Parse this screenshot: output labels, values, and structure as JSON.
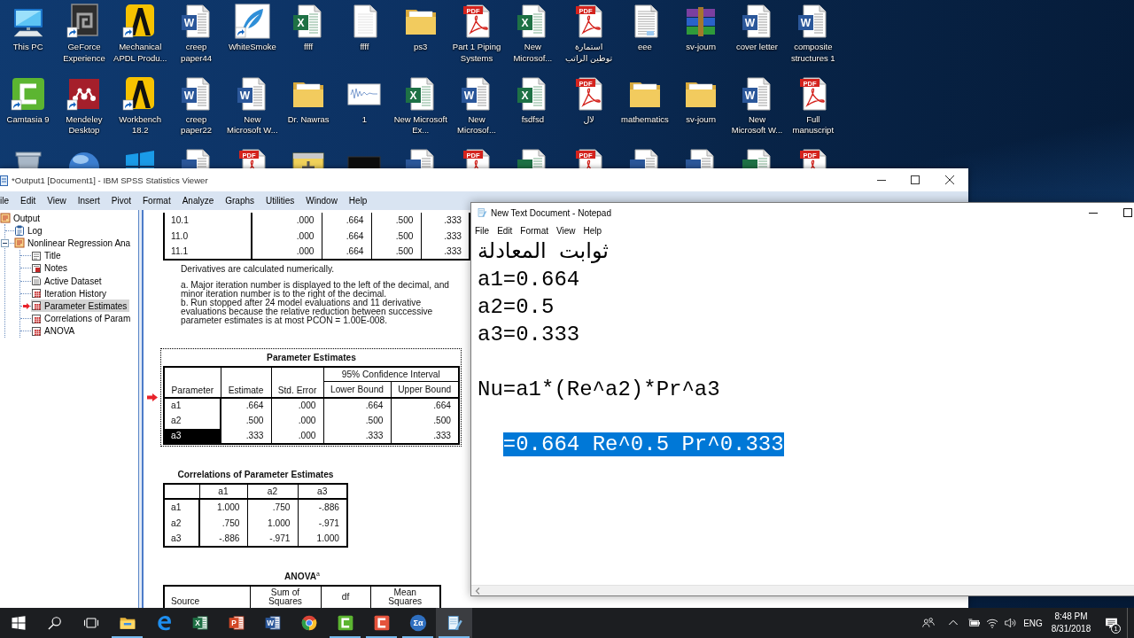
{
  "desktop": {
    "icons": [
      {
        "label": "This PC",
        "kind": "computer",
        "shortcut": false
      },
      {
        "label": "GeForce Experience",
        "kind": "geforce",
        "shortcut": true
      },
      {
        "label": "Mechanical APDL Produ...",
        "kind": "ansys",
        "shortcut": true
      },
      {
        "label": "creep paper44",
        "kind": "word",
        "badge": "W",
        "shortcut": false
      },
      {
        "label": "WhiteSmoke",
        "kind": "feather",
        "shortcut": true
      },
      {
        "label": "ffff",
        "kind": "excel",
        "badge": "X",
        "shortcut": false
      },
      {
        "label": "ffff",
        "kind": "blank",
        "shortcut": false
      },
      {
        "label": "ps3",
        "kind": "folder",
        "shortcut": false
      },
      {
        "label": "Part 1 Piping Systems",
        "kind": "pdf",
        "badge": "PDF",
        "shortcut": false
      },
      {
        "label": "New Microsof...",
        "kind": "excel",
        "badge": "X",
        "shortcut": false
      },
      {
        "label": "استمارة توطين الراتب",
        "kind": "pdf",
        "badge": "PDF",
        "shortcut": false
      },
      {
        "label": "eee",
        "kind": "scan",
        "shortcut": false
      },
      {
        "label": "sv-journ",
        "kind": "archive",
        "shortcut": false
      },
      {
        "label": "cover letter",
        "kind": "word",
        "badge": "W",
        "shortcut": false
      },
      {
        "label": "composite structures 1",
        "kind": "word",
        "badge": "W",
        "shortcut": false
      },
      {
        "label": "Camtasia 9",
        "kind": "camtasia",
        "shortcut": true
      },
      {
        "label": "Mendeley Desktop",
        "kind": "mendeley",
        "shortcut": true
      },
      {
        "label": "Workbench 18.2",
        "kind": "ansys",
        "shortcut": true
      },
      {
        "label": "creep paper22",
        "kind": "word",
        "badge": "W",
        "shortcut": false
      },
      {
        "label": "New Microsoft W...",
        "kind": "word",
        "badge": "W",
        "shortcut": false
      },
      {
        "label": "Dr. Nawras",
        "kind": "folder",
        "shortcut": false
      },
      {
        "label": "1",
        "kind": "image",
        "shortcut": false
      },
      {
        "label": "New Microsoft Ex...",
        "kind": "excel",
        "badge": "X",
        "shortcut": false
      },
      {
        "label": "New Microsof...",
        "kind": "word",
        "badge": "W",
        "shortcut": false
      },
      {
        "label": "fsdfsd",
        "kind": "excel",
        "badge": "X",
        "shortcut": false
      },
      {
        "label": "لال",
        "kind": "pdf",
        "badge": "PDF",
        "shortcut": false
      },
      {
        "label": "mathematics",
        "kind": "folder",
        "shortcut": false
      },
      {
        "label": "sv-journ",
        "kind": "folder",
        "shortcut": false
      },
      {
        "label": "New Microsoft W...",
        "kind": "word",
        "badge": "W",
        "shortcut": false
      },
      {
        "label": "Full manuscript",
        "kind": "pdf",
        "badge": "PDF",
        "shortcut": false
      }
    ],
    "covered_icons": [
      {
        "kind": "recycle"
      },
      {
        "kind": "sigma"
      },
      {
        "kind": "windows"
      },
      {
        "kind": "word"
      },
      {
        "kind": "pdf",
        "badge": "PDF"
      },
      {
        "kind": "labview"
      },
      {
        "kind": "screen"
      },
      {
        "kind": "word"
      },
      {
        "kind": "pdf",
        "badge": "PDF"
      },
      {
        "kind": "excel"
      },
      {
        "kind": "pdf",
        "badge": "PDF"
      },
      {
        "kind": "word"
      },
      {
        "kind": "word"
      },
      {
        "kind": "excel"
      },
      {
        "kind": "pdf",
        "badge": "PDF"
      }
    ]
  },
  "spss": {
    "title": "*Output1 [Document1] - IBM SPSS Statistics Viewer",
    "menu": [
      "ile",
      "Edit",
      "View",
      "Insert",
      "Pivot",
      "Format",
      "Analyze",
      "Graphs",
      "Utilities",
      "Window",
      "Help"
    ],
    "outline": [
      {
        "label": "Output",
        "kind": "book",
        "selected": false,
        "children": [
          {
            "label": "Log",
            "kind": "log",
            "selected": false
          },
          {
            "label": "Nonlinear Regression Ana",
            "kind": "book",
            "selected": false,
            "expanded": true,
            "children": [
              {
                "label": "Title",
                "kind": "title",
                "selected": false
              },
              {
                "label": "Notes",
                "kind": "notes",
                "selected": false
              },
              {
                "label": "Active Dataset",
                "kind": "dataset",
                "selected": false
              },
              {
                "label": "Iteration History",
                "kind": "table",
                "selected": false
              },
              {
                "label": "Parameter Estimates",
                "kind": "table",
                "selected": true
              },
              {
                "label": "Correlations of Param",
                "kind": "table",
                "selected": false
              },
              {
                "label": "ANOVA",
                "kind": "table",
                "selected": false
              }
            ]
          }
        ]
      }
    ],
    "tables": [
      {
        "kind": "iteration",
        "rows": [
          [
            "10.1",
            ".000",
            ".664",
            ".500",
            ".333"
          ],
          [
            "11.0",
            ".000",
            ".664",
            ".500",
            ".333"
          ],
          [
            "11.1",
            ".000",
            ".664",
            ".500",
            ".333"
          ]
        ],
        "note": "Derivatives are calculated numerically.",
        "footnotes": [
          "a. Major iteration number is displayed to the left of the decimal, and minor iteration number is to the right of the decimal.",
          "b. Run stopped after 24 model evaluations and 11 derivative evaluations because the relative reduction between successive parameter estimates is at most PCON = 1.00E-008."
        ]
      },
      {
        "kind": "estimates",
        "title": "Parameter Estimates",
        "selected": true,
        "columns": [
          "Parameter",
          "Estimate",
          "Std. Error"
        ],
        "group_header": "95% Confidence Interval",
        "group_columns": [
          "Lower Bound",
          "Upper Bound"
        ],
        "rows": [
          {
            "label": "a1",
            "selected": false,
            "values": [
              ".664",
              ".000",
              ".664",
              ".664"
            ]
          },
          {
            "label": "a2",
            "selected": false,
            "values": [
              ".500",
              ".000",
              ".500",
              ".500"
            ]
          },
          {
            "label": "a3",
            "selected": true,
            "values": [
              ".333",
              ".000",
              ".333",
              ".333"
            ]
          }
        ]
      },
      {
        "kind": "correlations",
        "title": "Correlations of Parameter Estimates",
        "selected": false,
        "columns": [
          "a1",
          "a2",
          "a3"
        ],
        "rows": [
          {
            "label": "a1",
            "values": [
              "1.000",
              ".750",
              "-.886"
            ]
          },
          {
            "label": "a2",
            "values": [
              ".750",
              "1.000",
              "-.971"
            ]
          },
          {
            "label": "a3",
            "values": [
              "-.886",
              "-.971",
              "1.000"
            ]
          }
        ]
      },
      {
        "kind": "anova",
        "title": "ANOVA$^{a}$",
        "selected": false,
        "columns": [
          "Source",
          "Sum of Squares",
          "df",
          "Mean Squares"
        ]
      }
    ]
  },
  "notepad": {
    "title": "New Text Document - Notepad",
    "menu": [
      "File",
      "Edit",
      "Format",
      "View",
      "Help"
    ],
    "text": "ثوابت المعادلة\na1=0.664\na2=0.5\na3=0.333\n\nNu=a1*(Re^a2)*Pr^a3\n\n  ",
    "selected_text": "=0.664 Re^0.5 Pr^0.333"
  },
  "taskbar": {
    "buttons": [
      {
        "kind": "start"
      },
      {
        "kind": "search"
      },
      {
        "kind": "taskview"
      }
    ],
    "apps": [
      {
        "kind": "explorer",
        "running": true,
        "active": false
      },
      {
        "kind": "edge",
        "running": false,
        "active": false
      },
      {
        "kind": "excel",
        "badge": "X",
        "running": false,
        "active": false
      },
      {
        "kind": "powerpoint",
        "badge": "P",
        "running": false,
        "active": false
      },
      {
        "kind": "word",
        "badge": "W",
        "running": false,
        "active": false
      },
      {
        "kind": "chrome",
        "running": false,
        "active": false
      },
      {
        "kind": "camtasia",
        "running": true,
        "active": false
      },
      {
        "kind": "recorder",
        "running": true,
        "active": false
      },
      {
        "kind": "sigma",
        "badge": "Σα",
        "running": true,
        "active": false
      },
      {
        "kind": "notepad",
        "running": true,
        "active": true
      }
    ],
    "tray": {
      "icons": [
        {
          "kind": "people"
        },
        {
          "kind": "chevron"
        },
        {
          "kind": "power"
        },
        {
          "kind": "wifi"
        },
        {
          "kind": "volume"
        }
      ],
      "language": "ENG",
      "time": "8:48 PM",
      "date": "8/31/2018",
      "notifications": "1"
    }
  }
}
